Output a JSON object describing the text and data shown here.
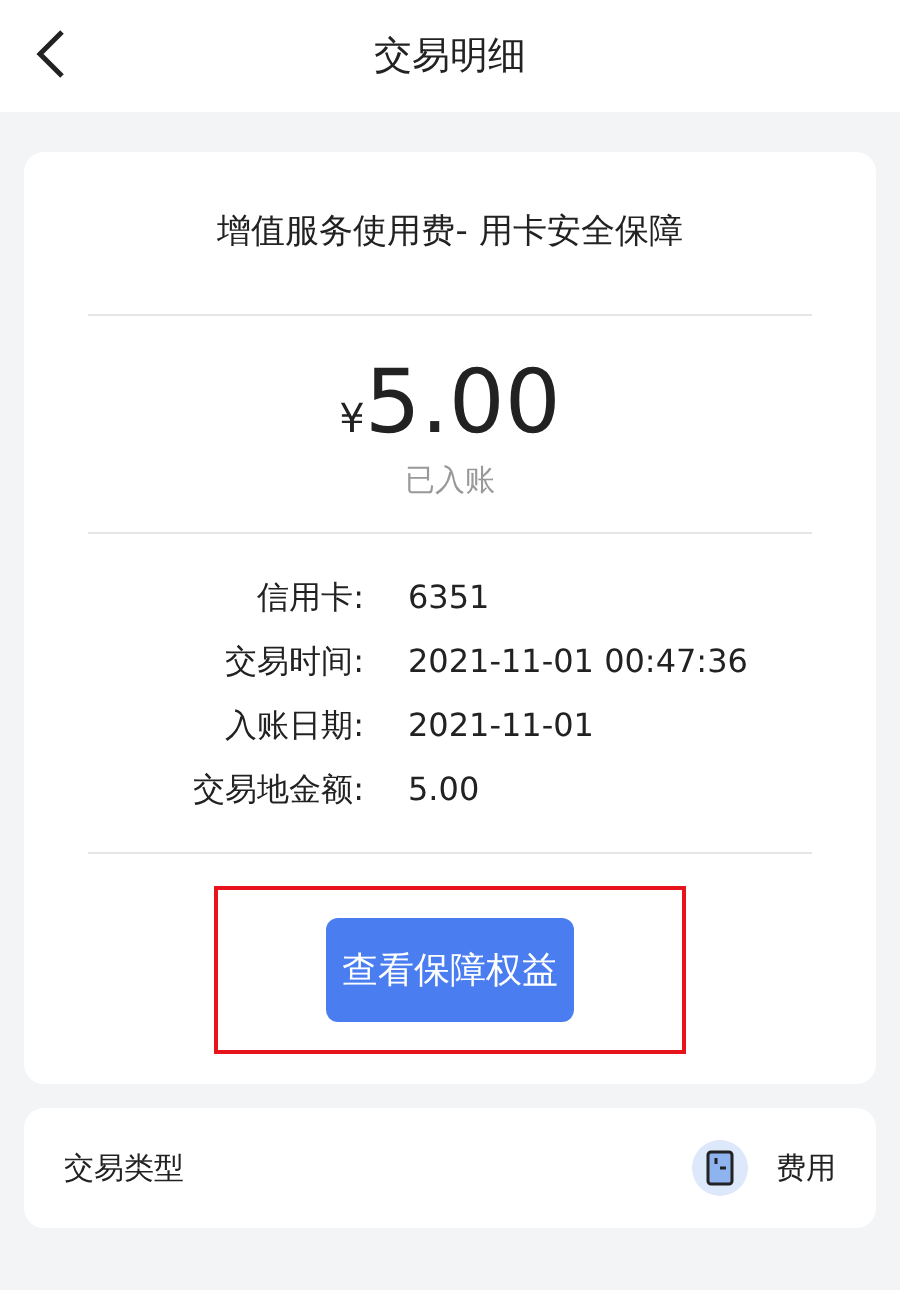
{
  "header": {
    "title": "交易明细"
  },
  "card": {
    "description": "增值服务使用费- 用卡安全保障",
    "currency": "¥",
    "amount": "5.00",
    "status": "已入账",
    "details": [
      {
        "label": "信用卡:",
        "value": "6351"
      },
      {
        "label": "交易时间:",
        "value": "2021-11-01 00:47:36"
      },
      {
        "label": "入账日期:",
        "value": "2021-11-01"
      },
      {
        "label": "交易地金额:",
        "value": "5.00"
      }
    ],
    "button": {
      "label": "查看保障权益",
      "highlighted": true
    }
  },
  "type_row": {
    "label": "交易类型",
    "value": "费用"
  }
}
